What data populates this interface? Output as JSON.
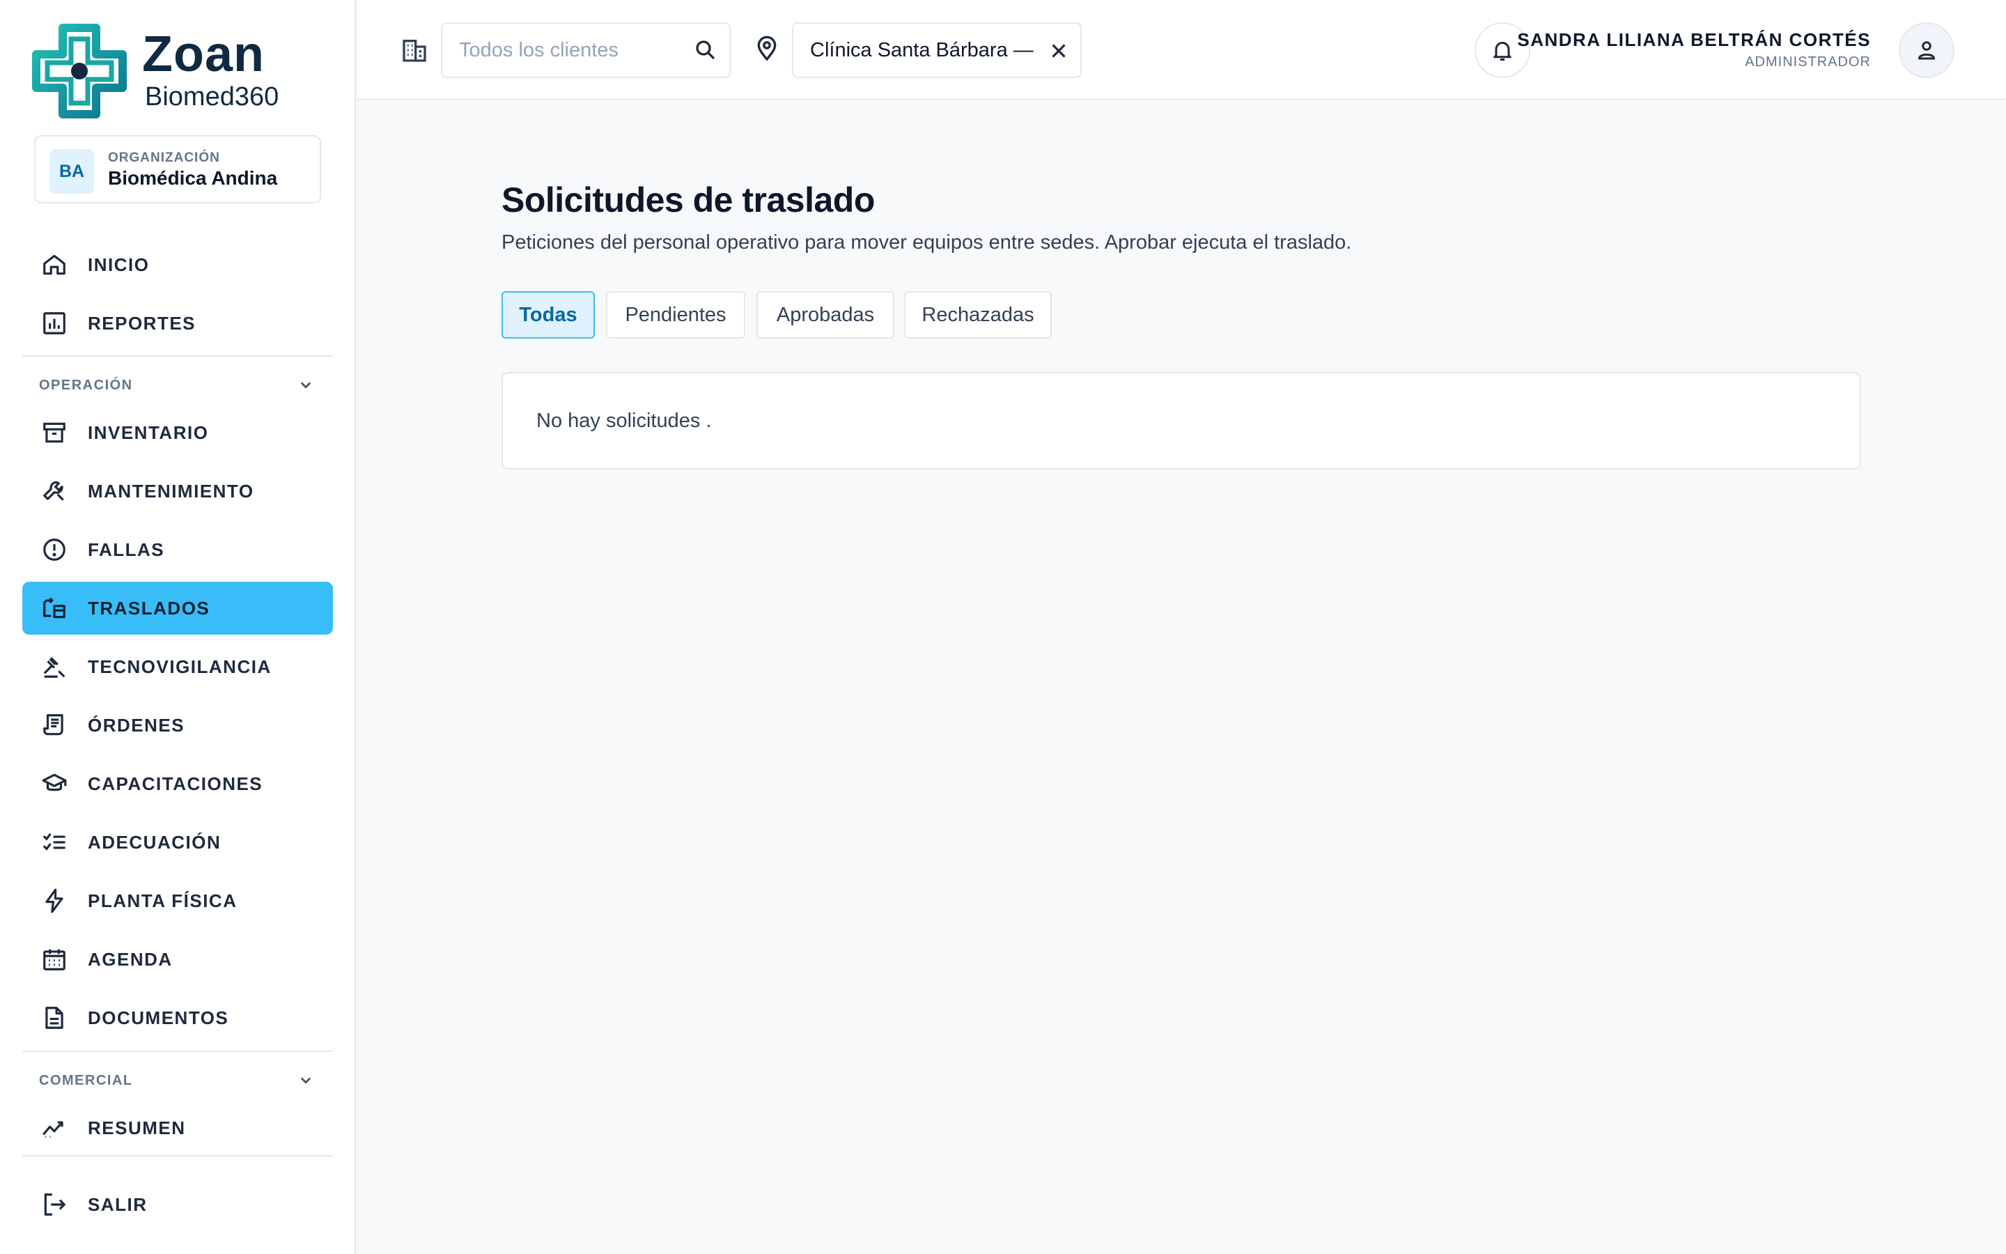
{
  "brand": {
    "name": "Zoan",
    "product": "Biomed360"
  },
  "organization": {
    "initials": "BA",
    "label": "ORGANIZACIÓN",
    "name": "Biomédica Andina"
  },
  "nav": {
    "top": [
      {
        "label": "INICIO",
        "icon": "home-icon"
      },
      {
        "label": "REPORTES",
        "icon": "bar-chart-icon"
      }
    ],
    "operacion_label": "OPERACIÓN",
    "operacion": [
      {
        "label": "INVENTARIO",
        "icon": "archive-box-icon"
      },
      {
        "label": "MANTENIMIENTO",
        "icon": "wrench-icon"
      },
      {
        "label": "FALLAS",
        "icon": "alert-circle-icon"
      },
      {
        "label": "TRASLADOS",
        "icon": "transfer-icon",
        "active": true
      },
      {
        "label": "TECNOVIGILANCIA",
        "icon": "gavel-icon"
      },
      {
        "label": "ÓRDENES",
        "icon": "receipt-icon"
      },
      {
        "label": "CAPACITACIONES",
        "icon": "graduation-cap-icon"
      },
      {
        "label": "ADECUACIÓN",
        "icon": "checklist-icon"
      },
      {
        "label": "PLANTA FÍSICA",
        "icon": "lightning-icon"
      },
      {
        "label": "AGENDA",
        "icon": "calendar-icon"
      },
      {
        "label": "DOCUMENTOS",
        "icon": "document-icon"
      }
    ],
    "comercial_label": "COMERCIAL",
    "comercial": [
      {
        "label": "RESUMEN",
        "icon": "trending-icon"
      }
    ],
    "logout": {
      "label": "SALIR",
      "icon": "logout-icon"
    }
  },
  "topbar": {
    "client_search_placeholder": "Todos los clientes",
    "site_value": "Clínica Santa Bárbara —",
    "user_name": "SANDRA LILIANA BELTRÁN CORTÉS",
    "user_role": "ADMINISTRADOR"
  },
  "main": {
    "title": "Solicitudes de traslado",
    "description": "Peticiones del personal operativo para mover equipos entre sedes. Aprobar ejecuta el traslado.",
    "tabs": [
      {
        "label": "Todas",
        "active": true
      },
      {
        "label": "Pendientes"
      },
      {
        "label": "Aprobadas"
      },
      {
        "label": "Rechazadas"
      }
    ],
    "empty_message": "No hay solicitudes ."
  },
  "colors": {
    "accent": "#38bdf8",
    "brand_teal": "#14a3a3",
    "brand_navy": "#102a43"
  }
}
